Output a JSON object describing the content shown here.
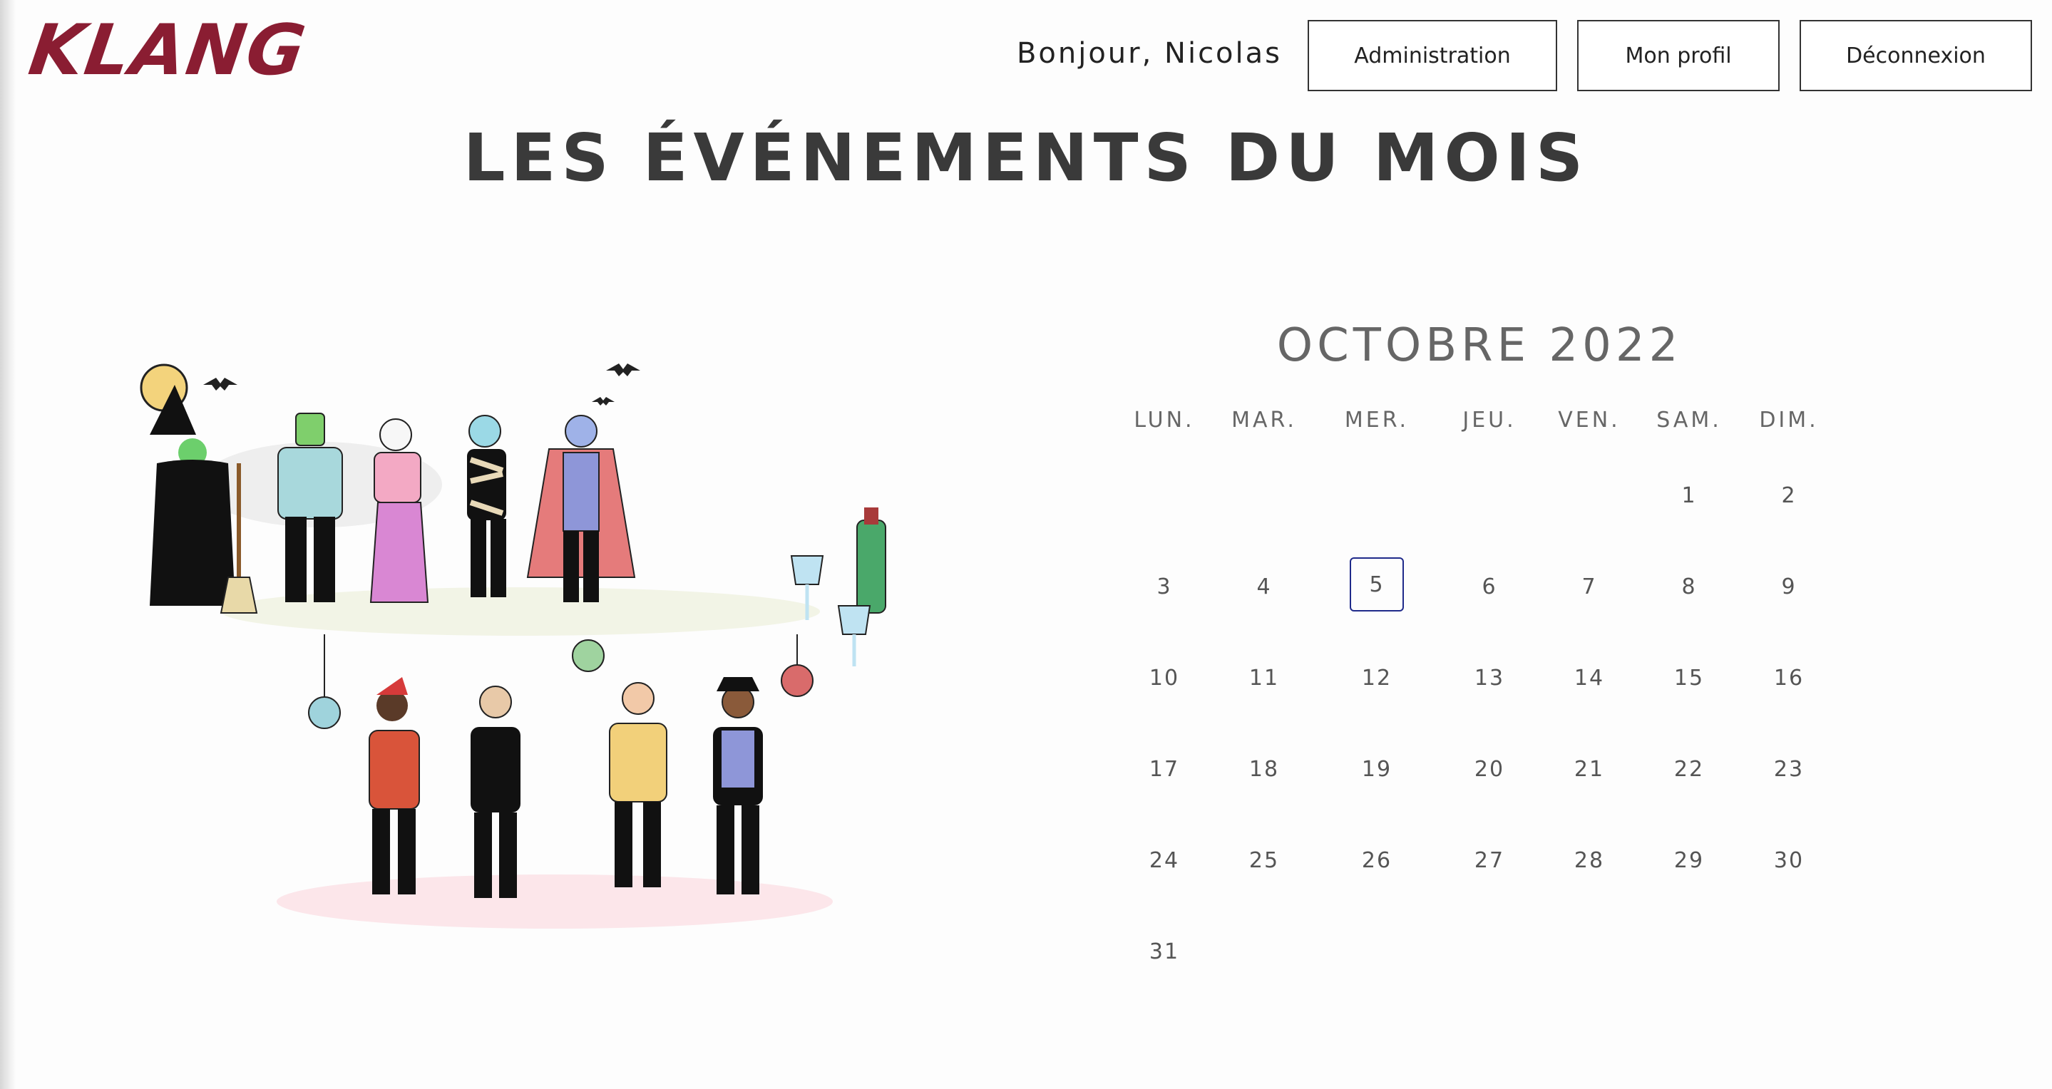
{
  "header": {
    "logo": "KLANG",
    "greeting": "Bonjour, Nicolas",
    "buttons": [
      "Administration",
      "Mon profil",
      "Déconnexion"
    ]
  },
  "page_title": "LES ÉVÉNEMENTS DU MOIS",
  "calendar": {
    "title": "OCTOBRE 2022",
    "weekdays": [
      "LUN.",
      "MAR.",
      "MER.",
      "JEU.",
      "VEN.",
      "SAM.",
      "DIM."
    ],
    "first_weekday_index": 5,
    "days_in_month": 31,
    "selected_day": "5"
  },
  "colors": {
    "brand": "#8a1d32",
    "selected_border": "#1f2a8a"
  }
}
